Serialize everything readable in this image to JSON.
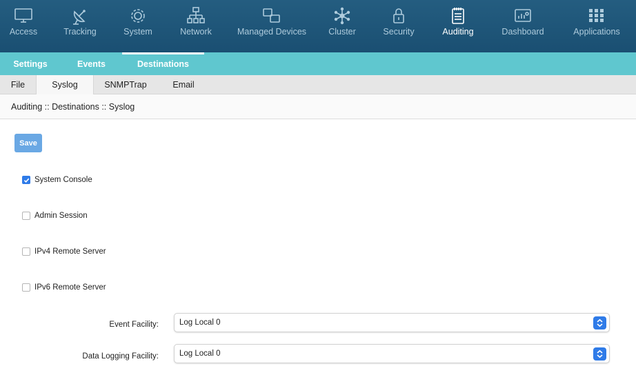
{
  "topnav": {
    "items": [
      {
        "label": "Access",
        "icon": "monitor-icon"
      },
      {
        "label": "Tracking",
        "icon": "satellite-dish-icon"
      },
      {
        "label": "System",
        "icon": "gear-icon"
      },
      {
        "label": "Network",
        "icon": "network-icon"
      },
      {
        "label": "Managed Devices",
        "icon": "managed-devices-icon"
      },
      {
        "label": "Cluster",
        "icon": "cluster-icon"
      },
      {
        "label": "Security",
        "icon": "lock-icon"
      },
      {
        "label": "Auditing",
        "icon": "notepad-icon"
      },
      {
        "label": "Dashboard",
        "icon": "dashboard-icon"
      },
      {
        "label": "Applications",
        "icon": "grid-icon"
      }
    ],
    "active": "Auditing"
  },
  "subnav": {
    "items": [
      {
        "label": "Settings"
      },
      {
        "label": "Events"
      },
      {
        "label": "Destinations"
      }
    ],
    "active": "Destinations"
  },
  "tabs": {
    "items": [
      {
        "label": "File"
      },
      {
        "label": "Syslog"
      },
      {
        "label": "SNMPTrap"
      },
      {
        "label": "Email"
      }
    ],
    "active": "Syslog"
  },
  "breadcrumb": "Auditing :: Destinations :: Syslog",
  "toolbar": {
    "save_label": "Save"
  },
  "options": [
    {
      "label": "System Console",
      "checked": true
    },
    {
      "label": "Admin Session",
      "checked": false
    },
    {
      "label": "IPv4 Remote Server",
      "checked": false
    },
    {
      "label": "IPv6 Remote Server",
      "checked": false
    }
  ],
  "fields": {
    "event_facility": {
      "label": "Event Facility:",
      "value": "Log Local 0"
    },
    "data_logging_facility": {
      "label": "Data Logging Facility:",
      "value": "Log Local 0"
    }
  },
  "colors": {
    "topnav_bg": "#1f5678",
    "subnav_bg": "#5fc7cf",
    "accent_blue": "#2f7be8",
    "save_button": "#6aa8e4"
  }
}
